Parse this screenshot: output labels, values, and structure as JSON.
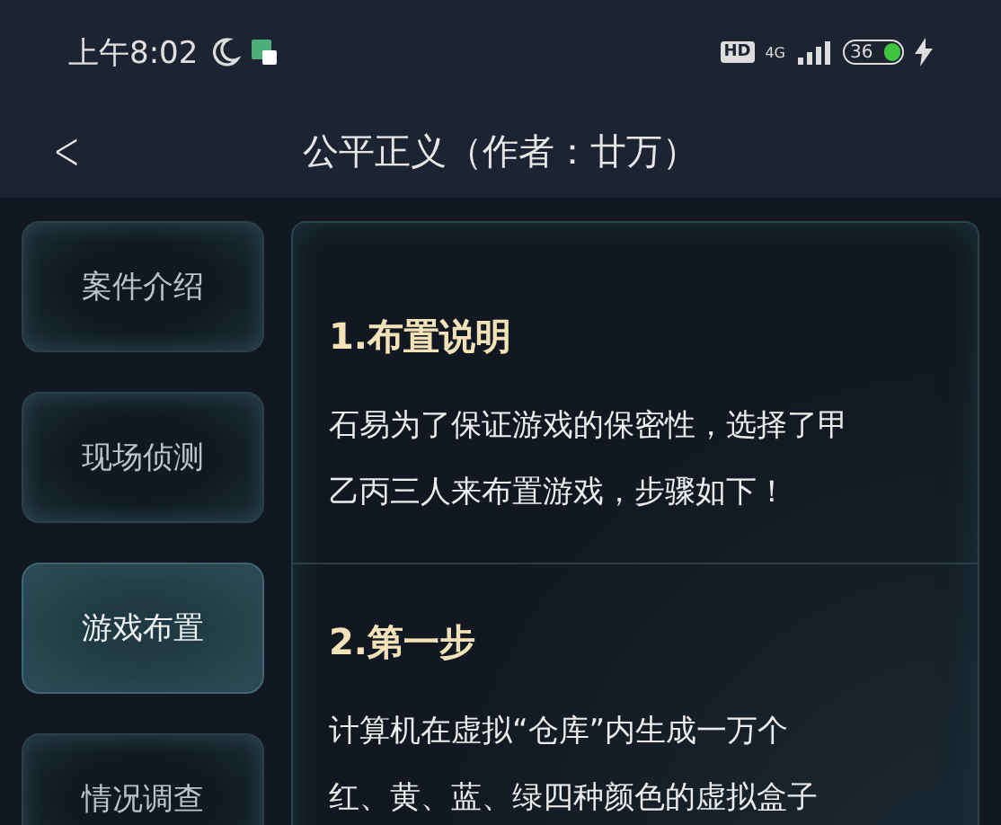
{
  "status_bar": {
    "time": "上午8:02",
    "hd": "HD",
    "network": "4G",
    "battery": "36"
  },
  "header": {
    "back": "<",
    "title": "公平正义（作者：廿万）"
  },
  "sidebar": {
    "items": [
      {
        "label": "案件介绍",
        "selected": false
      },
      {
        "label": "现场侦测",
        "selected": false
      },
      {
        "label": "游戏布置",
        "selected": true
      },
      {
        "label": "情况调查",
        "selected": false
      }
    ]
  },
  "sections": [
    {
      "heading": "1.布置说明",
      "lines": [
        "石易为了保证游戏的保密性，选择了甲",
        "乙丙三人来布置游戏，步骤如下！"
      ]
    },
    {
      "heading": "2.第一步",
      "lines": [
        "计算机在虚拟“仓库”内生成一万个",
        "红、黄、蓝、绿四种颜色的虚拟盒子"
      ]
    }
  ]
}
